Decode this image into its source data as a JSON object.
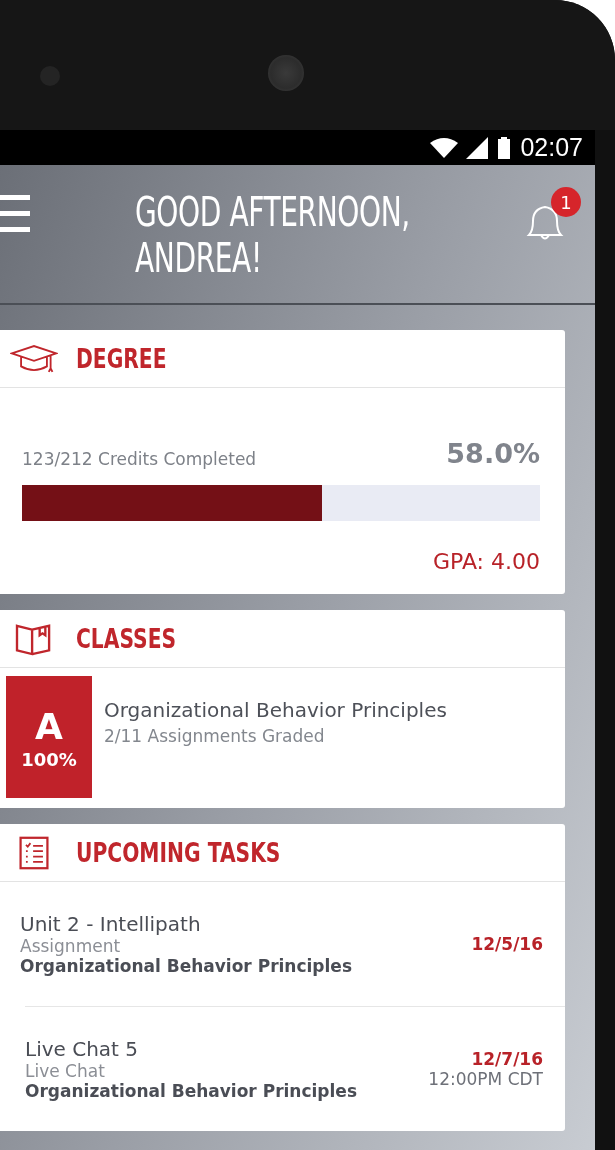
{
  "status_bar": {
    "time": "02:07"
  },
  "header": {
    "greeting": "GOOD AFTERNOON, ANDREA!",
    "notification_count": "1"
  },
  "degree": {
    "title": "DEGREE",
    "credits": "123/212 Credits Completed",
    "percent": "58.0%",
    "level": 0.58,
    "gpa": "GPA: 4.00"
  },
  "classes": {
    "title": "CLASSES",
    "items": [
      {
        "grade": "A",
        "score": "100%",
        "name": "Organizational Behavior Principles",
        "assignments": "2/11 Assignments Graded"
      }
    ]
  },
  "upcoming_tasks": {
    "title": "UPCOMING TASKS",
    "items": [
      {
        "name": "Unit 2 - Intellipath",
        "type": "Assignment",
        "course": "Organizational Behavior Principles",
        "date": "12/5/16"
      },
      {
        "name": "Live Chat 5",
        "type": "Live Chat",
        "course": "Organizational Behavior Principles",
        "date": "12/7/16",
        "time": "12:00PM CDT"
      }
    ]
  }
}
